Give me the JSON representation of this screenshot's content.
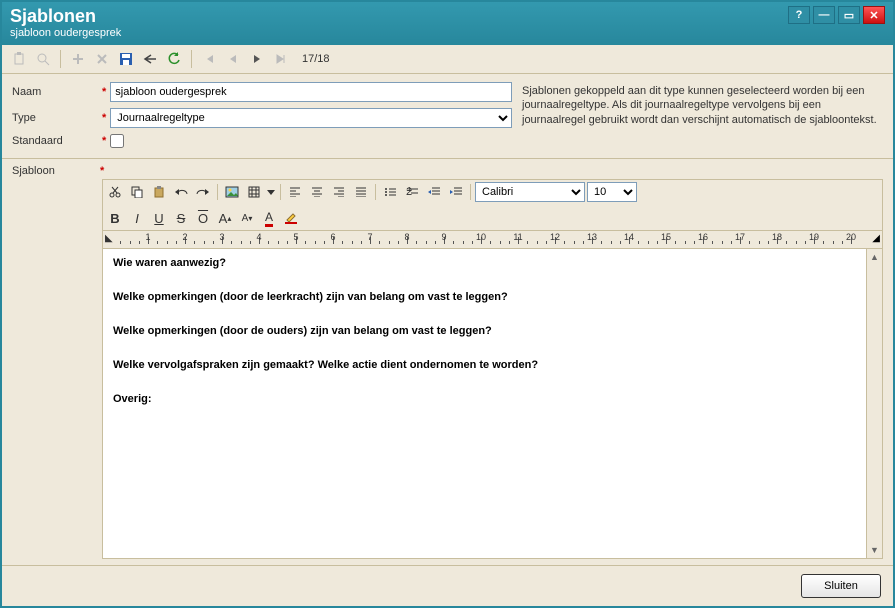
{
  "window": {
    "title": "Sjablonen",
    "subtitle": "sjabloon oudergesprek"
  },
  "nav": {
    "counter": "17/18"
  },
  "form": {
    "naam_label": "Naam",
    "naam_value": "sjabloon oudergesprek",
    "type_label": "Type",
    "type_value": "Journaalregeltype",
    "standaard_label": "Standaard",
    "help": "Sjablonen gekoppeld aan dit type kunnen geselecteerd worden bij een journaalregeltype. Als dit journaalregeltype vervolgens bij een journaalregel gebruikt wordt dan verschijnt automatisch de sjabloontekst."
  },
  "sjablon_label": "Sjabloon",
  "rtf": {
    "font": "Calibri",
    "size": "10"
  },
  "content": {
    "q1": "Wie waren aanwezig?",
    "q2": "Welke opmerkingen (door de leerkracht) zijn van belang om vast te leggen?",
    "q3": "Welke opmerkingen (door de ouders) zijn van belang om vast te leggen?",
    "q4": "Welke vervolgafspraken zijn gemaakt? Welke actie dient ondernomen te worden?",
    "q5": "Overig:"
  },
  "footer": {
    "close": "Sluiten"
  },
  "ruler": {
    "max": 20
  }
}
